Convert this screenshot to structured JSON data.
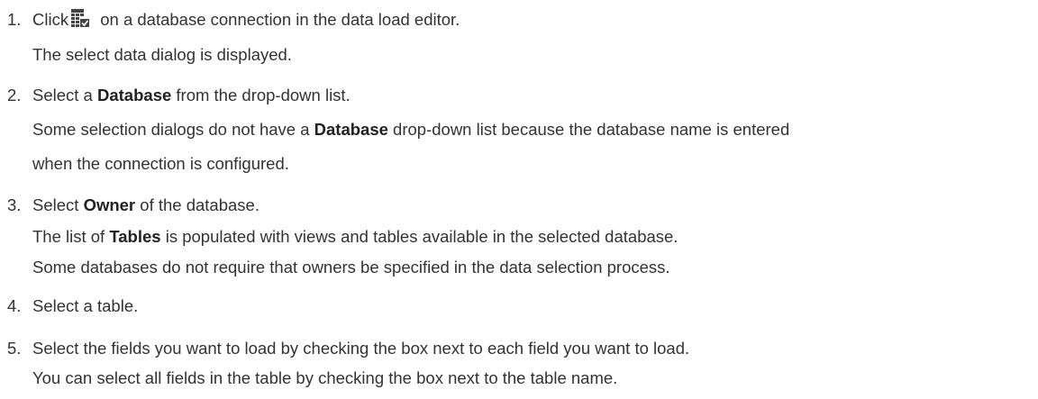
{
  "steps": [
    {
      "number": "1.",
      "lines": [
        {
          "before": "Click",
          "icon": "select-data-icon",
          "after": " on a database connection in the data load editor."
        },
        {
          "text": "The select data dialog is displayed."
        }
      ]
    },
    {
      "number": "2.",
      "lines": [
        {
          "a": "Select a ",
          "bold": "Database",
          "b": " from the drop-down list."
        },
        {
          "a": "Some selection dialogs do not have a ",
          "bold": "Database",
          "b": " drop-down list because the database name is entered"
        },
        {
          "text": "when the connection is configured."
        }
      ]
    },
    {
      "number": "3.",
      "lines": [
        {
          "a": "Select ",
          "bold": "Owner",
          "b": " of the database."
        },
        {
          "a": "The list of ",
          "bold": "Tables",
          "b": " is populated with views and tables available in the selected database."
        },
        {
          "text": "Some databases do not require that owners be specified in the data selection process."
        }
      ]
    },
    {
      "number": "4.",
      "lines": [
        {
          "text": "Select a table."
        }
      ]
    },
    {
      "number": "5.",
      "lines": [
        {
          "text": "Select the fields you want to load by checking the box next to each field you want to load."
        },
        {
          "text": "You can select all fields in the table by checking the box next to the table name."
        }
      ]
    }
  ],
  "colors": {
    "text": "#333333",
    "icon": "#444444"
  }
}
